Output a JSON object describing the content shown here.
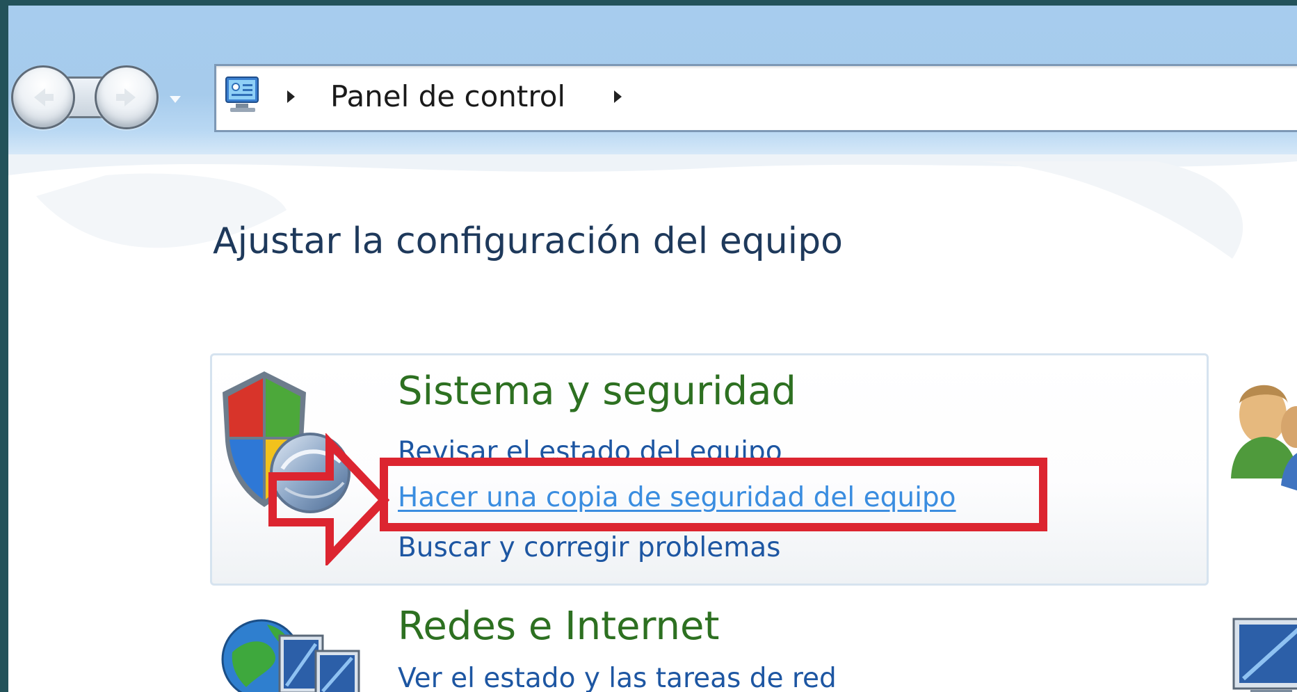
{
  "address_bar": {
    "breadcrumb": "Panel de control"
  },
  "heading": "Ajustar la configuración del equipo",
  "categories": [
    {
      "title": "Sistema y seguridad",
      "links": [
        "Revisar el estado del equipo",
        "Hacer una copia de seguridad del equipo",
        "Buscar y corregir problemas"
      ],
      "icon": "security-shield-icon"
    },
    {
      "title": "Redes e Internet",
      "links": [
        "Ver el estado y las tareas de red"
      ],
      "icon": "network-globe-icon"
    }
  ],
  "annotation": {
    "highlighted_link": "Hacer una copia de seguridad del equipo",
    "color": "#dc2530"
  },
  "colors": {
    "category_title": "#2d7021",
    "link": "#1d56a2",
    "link_hover": "#3a8de0",
    "heading": "#1e395b",
    "chrome": "#a7ccee"
  }
}
